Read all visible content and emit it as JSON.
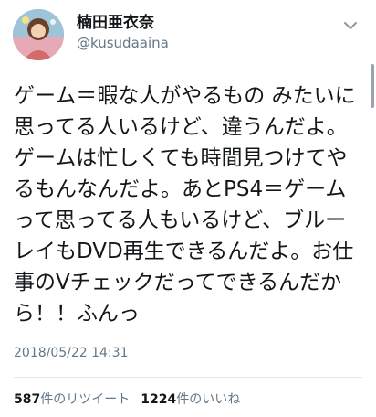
{
  "user": {
    "display_name": "楠田亜衣奈",
    "screen_name": "@kusudaaina"
  },
  "tweet": {
    "text": "ゲーム＝暇な人がやるもの みたいに思ってる人いるけど、違うんだよ。ゲームは忙しくても時間見つけてやるもんなんだよ。あとPS4＝ゲームって思ってる人もいるけど、ブルーレイもDVD再生できるんだよ。お仕事のVチェックだってできるんだから！！ふんっ",
    "timestamp": "2018/05/22 14:31"
  },
  "stats": {
    "retweets_count": "587",
    "retweets_label": "件のリツイート",
    "likes_count": "1224",
    "likes_label": "件のいいね"
  },
  "icons": {
    "avatar": "profile-photo",
    "caret": "chevron-down-icon"
  },
  "colors": {
    "text": "#14171a",
    "secondary": "#657786",
    "divider": "#e1e8ed"
  }
}
